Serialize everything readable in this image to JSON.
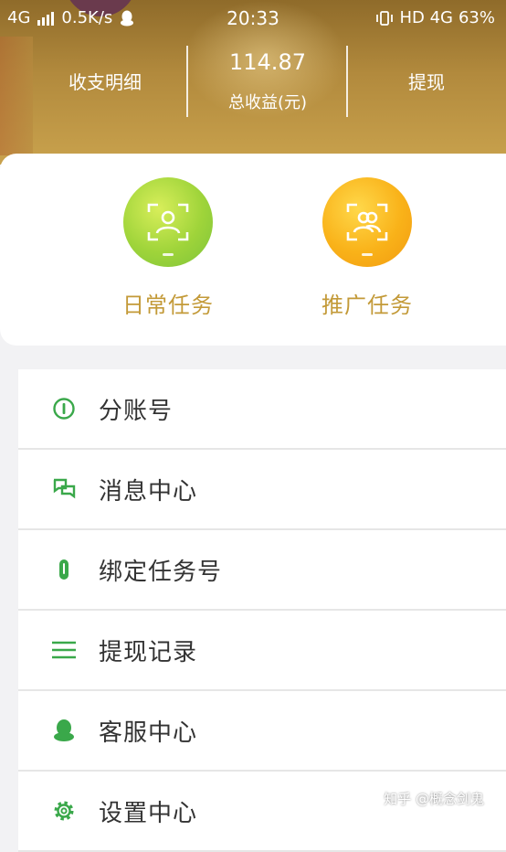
{
  "status_bar": {
    "network": "4G",
    "speed": "0.5K/s",
    "time": "20:33",
    "right_network": "HD 4G",
    "battery": "63%"
  },
  "stats": {
    "left_label": "收支明细",
    "total_value": "114.87",
    "total_label": "总收益(元)",
    "right_label": "提现"
  },
  "tasks": [
    {
      "label": "日常任务",
      "icon": "person-frame-icon",
      "color": "#9fd43a"
    },
    {
      "label": "推广任务",
      "icon": "group-frame-icon",
      "color": "#f9b219"
    }
  ],
  "menu": [
    {
      "label": "分账号",
      "icon": "info-circle-icon"
    },
    {
      "label": "消息中心",
      "icon": "chat-bubbles-icon"
    },
    {
      "label": "绑定任务号",
      "icon": "paperclip-icon"
    },
    {
      "label": "提现记录",
      "icon": "list-lines-icon"
    },
    {
      "label": "客服中心",
      "icon": "qq-penguin-icon"
    },
    {
      "label": "设置中心",
      "icon": "gear-icon"
    }
  ],
  "accent_green": "#3aa84a",
  "watermark": "知乎 @概念剑鬼"
}
